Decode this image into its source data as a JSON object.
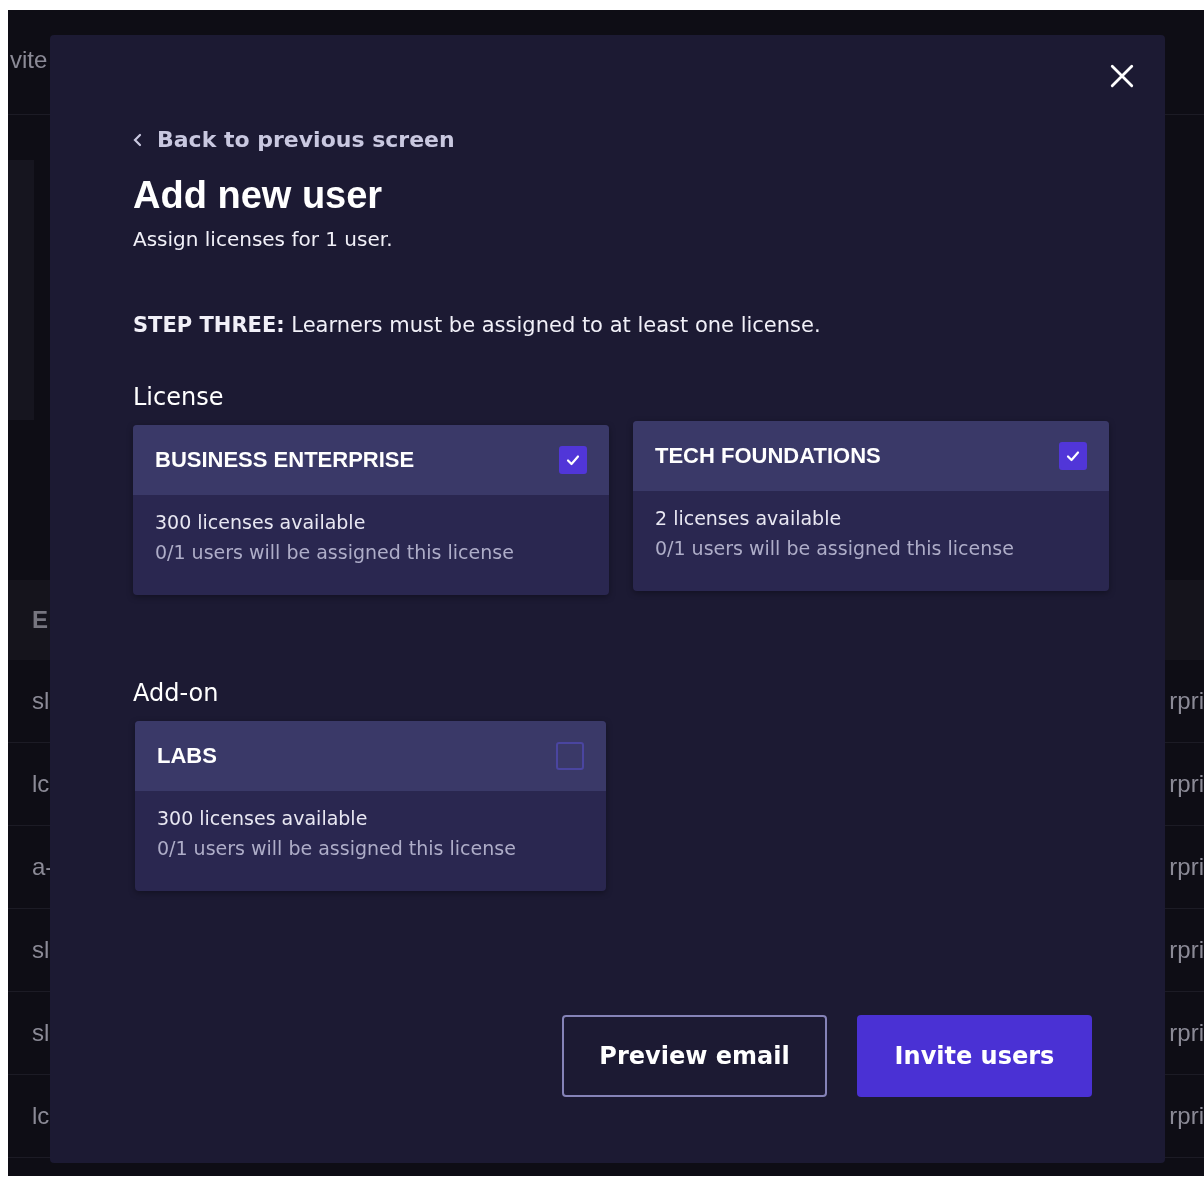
{
  "background": {
    "header_text": "vite",
    "table_header": "E",
    "rows": [
      {
        "column_1": "sl",
        "column_2": "rpri"
      },
      {
        "column_1": "lc",
        "column_2": "rpri"
      },
      {
        "column_1": "a-",
        "column_2": "rpri"
      },
      {
        "column_1": "sl",
        "column_2": "rpri"
      },
      {
        "column_1": "sl",
        "column_2": "rpri"
      },
      {
        "column_1": "lc",
        "column_2": "rpri"
      }
    ]
  },
  "dialog": {
    "back_link": "Back to previous screen",
    "title": "Add new user",
    "subtitle": "Assign licenses for 1 user.",
    "step": "**STEP THREE:** Learners must be assigned to at least one license.",
    "sections": [
      {
        "heading": "License",
        "cards": [
          {
            "name": "BUSINESS ENTERPRISE",
            "checked": true,
            "available": "300 licenses available",
            "assigned": "0/1 users will be assigned this license"
          },
          {
            "name": "TECH FOUNDATIONS",
            "checked": true,
            "available": "2 licenses available",
            "assigned": "0/1 users will be assigned this license"
          }
        ]
      },
      {
        "heading": "Add-on",
        "cards": [
          {
            "name": "LABS",
            "checked": false,
            "available": "300 licenses available",
            "assigned": "0/1 users will be assigned this license"
          }
        ]
      }
    ],
    "buttons": [
      {
        "label": "Preview email",
        "kind": "secondary"
      },
      {
        "label": "Invite users",
        "kind": "primary"
      }
    ]
  }
}
